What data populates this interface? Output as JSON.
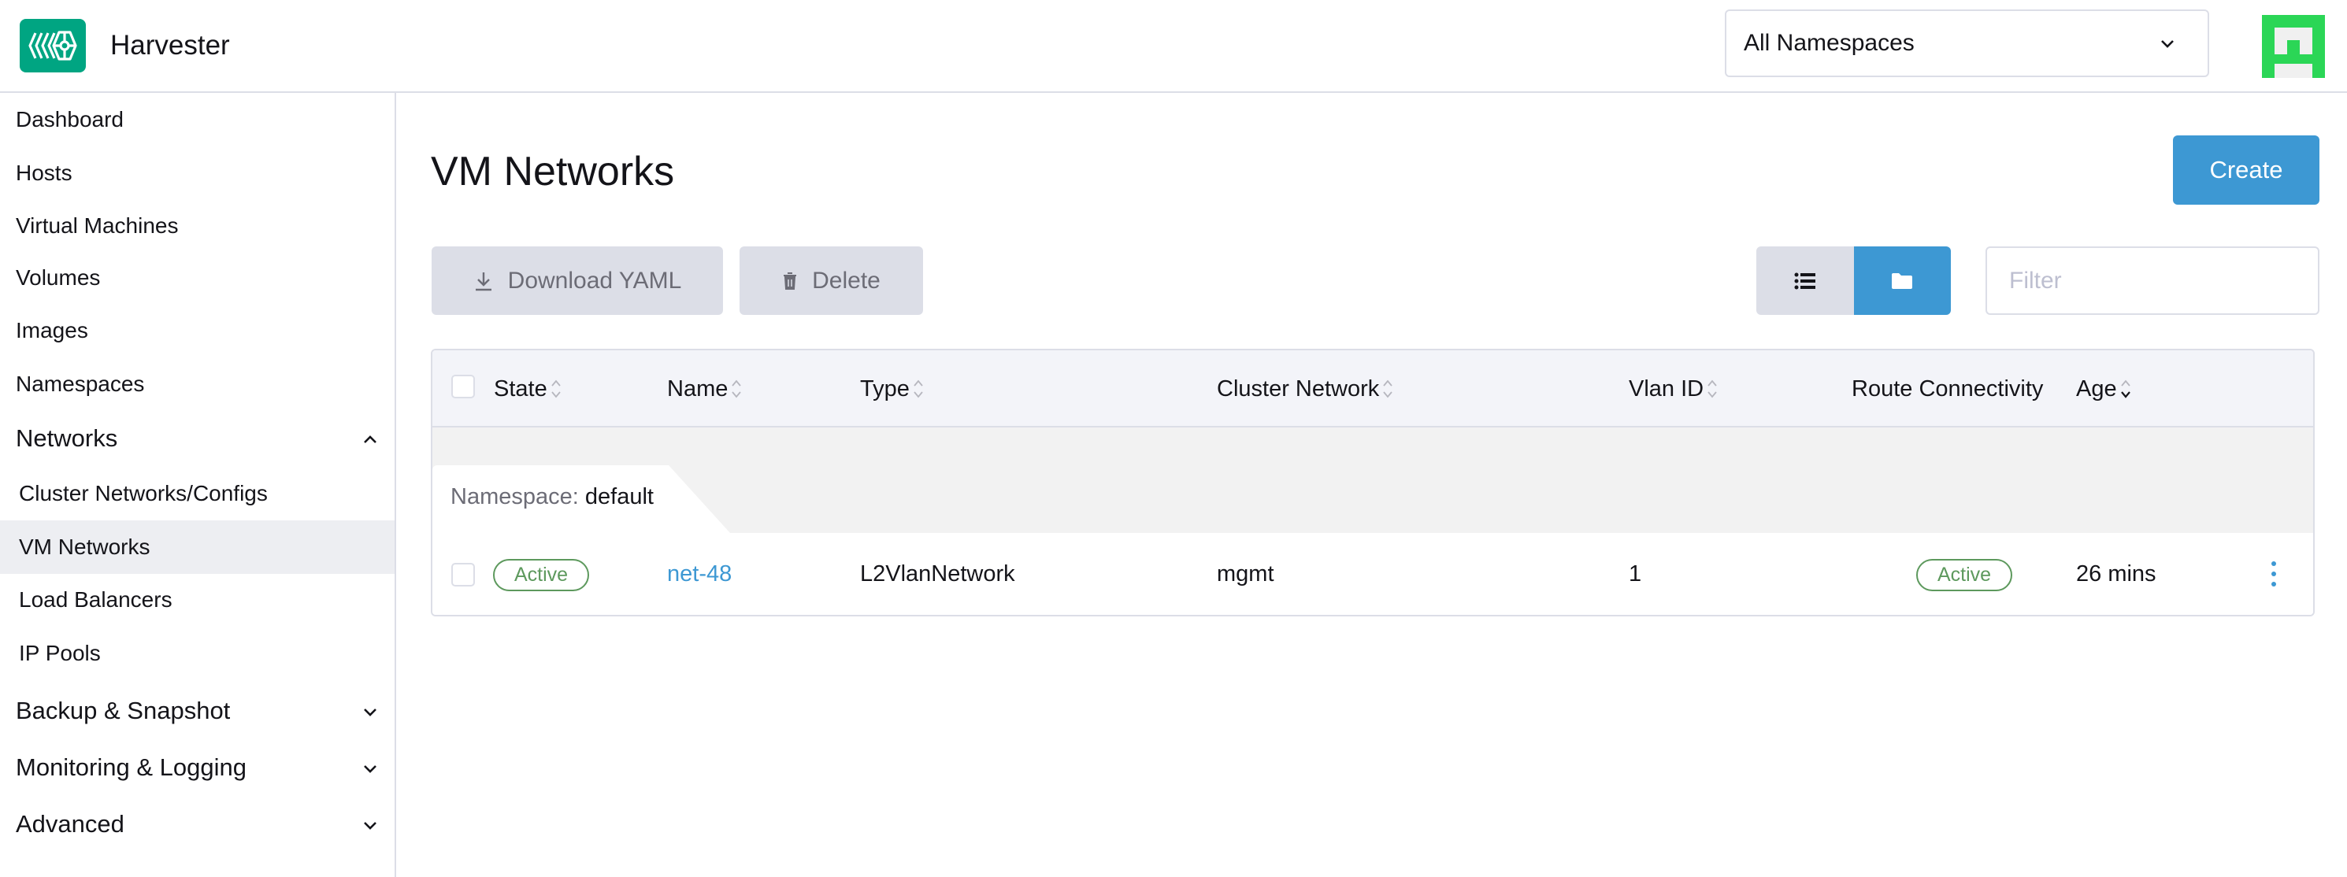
{
  "header": {
    "app_title": "Harvester",
    "namespace_select": {
      "selected": "All Namespaces"
    },
    "brand_color": "#00A582",
    "avatar_color": "#2BD656"
  },
  "sidebar": {
    "items": [
      {
        "label": "Dashboard",
        "type": "top"
      },
      {
        "label": "Hosts",
        "type": "top"
      },
      {
        "label": "Virtual Machines",
        "type": "top"
      },
      {
        "label": "Volumes",
        "type": "top"
      },
      {
        "label": "Images",
        "type": "top"
      },
      {
        "label": "Namespaces",
        "type": "top"
      },
      {
        "label": "Networks",
        "type": "group",
        "expanded": true
      },
      {
        "label": "Cluster Networks/Configs",
        "type": "sub"
      },
      {
        "label": "VM Networks",
        "type": "sub",
        "active": true
      },
      {
        "label": "Load Balancers",
        "type": "sub"
      },
      {
        "label": "IP Pools",
        "type": "sub"
      },
      {
        "label": "Backup & Snapshot",
        "type": "group",
        "expanded": false
      },
      {
        "label": "Monitoring & Logging",
        "type": "group",
        "expanded": false
      },
      {
        "label": "Advanced",
        "type": "group",
        "expanded": false
      }
    ]
  },
  "main": {
    "title": "VM Networks",
    "create_label": "Create",
    "download_yaml_label": "Download YAML",
    "delete_label": "Delete",
    "view_toggle": {
      "list_icon": "list-icon",
      "group_icon": "folder-icon",
      "active": "group"
    },
    "filter": {
      "placeholder": "Filter",
      "value": ""
    },
    "accent_color": "#3D98D3"
  },
  "table": {
    "columns": [
      {
        "label": "State",
        "sortable": true
      },
      {
        "label": "Name",
        "sortable": true
      },
      {
        "label": "Type",
        "sortable": true
      },
      {
        "label": "Cluster Network",
        "sortable": true
      },
      {
        "label": "Vlan ID",
        "sortable": true
      },
      {
        "label": "Route Connectivity",
        "sortable": false
      },
      {
        "label": "Age",
        "sortable": true,
        "sorted": "desc"
      }
    ],
    "groups": [
      {
        "key_label": "Namespace:",
        "value": "default",
        "rows": [
          {
            "state": "Active",
            "name": "net-48",
            "type": "L2VlanNetwork",
            "cluster_network": "mgmt",
            "vlan_id": "1",
            "route_connectivity": "Active",
            "age": "26 mins"
          }
        ]
      }
    ],
    "status_color": "#5D995D"
  }
}
